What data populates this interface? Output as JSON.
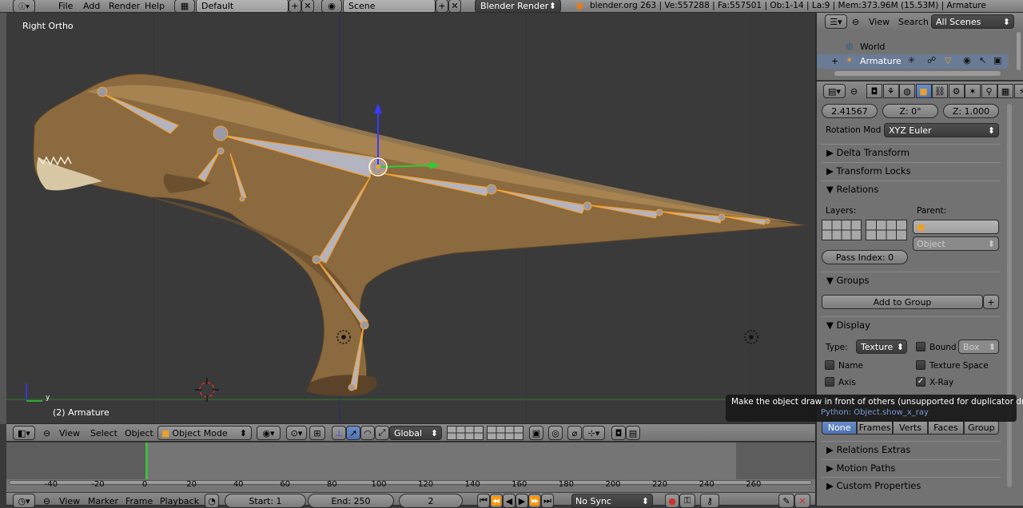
{
  "top_bar": {
    "menus": [
      "File",
      "Add",
      "Render",
      "Help"
    ],
    "screen_layout": "Default",
    "scene": "Scene",
    "render_engine": "Blender Render",
    "stats": "blender.org 263 | Ve:557288 | Fa:557501 | Ob:1-14 | La:9 | Mem:373.96M (15.53M) | Armature"
  },
  "viewport": {
    "view_label": "Right Ortho",
    "object_label": "(2) Armature",
    "axis_label": "y"
  },
  "view3d_header": {
    "menus": [
      "View",
      "Select",
      "Object"
    ],
    "mode": "Object Mode",
    "orientation": "Global"
  },
  "timeline": {
    "ticks": [
      "-40",
      "-20",
      "0",
      "20",
      "40",
      "60",
      "80",
      "100",
      "120",
      "140",
      "160",
      "180",
      "200",
      "220",
      "240",
      "260"
    ],
    "current_frame_marker": "0"
  },
  "timeline_header": {
    "menus": [
      "View",
      "Marker",
      "Frame",
      "Playback"
    ],
    "start": "Start: 1",
    "end": "End: 250",
    "current": "2",
    "sync": "No Sync"
  },
  "outliner": {
    "menus": [
      "View",
      "Search"
    ],
    "scene_filter": "All Scenes",
    "items": [
      "World",
      "Armature"
    ]
  },
  "properties": {
    "scale_x": "2.41567",
    "scale_z_rot": "Z: 0°",
    "scale_z": "Z: 1.000",
    "rotation_mode_label": "Rotation Mod",
    "rotation_mode": "XYZ Euler",
    "panels": {
      "delta_transform": "Delta Transform",
      "transform_locks": "Transform Locks",
      "relations": "Relations",
      "groups": "Groups",
      "display": "Display",
      "relations_extras": "Relations Extras",
      "motion_paths": "Motion Paths",
      "custom_properties": "Custom Properties"
    },
    "layers_label": "Layers:",
    "parent_label": "Parent:",
    "parent_type": "Object",
    "pass_index": "Pass Index: 0",
    "add_to_group": "Add to Group",
    "type_label": "Type:",
    "type_value": "Texture",
    "bound_label": "Bound",
    "bound_value": "Box",
    "name_label": "Name",
    "texture_space_label": "Texture Space",
    "axis_label": "Axis",
    "xray_label": "X-Ray",
    "xray_checked": true,
    "dup_tabs": [
      "None",
      "Frames",
      "Verts",
      "Faces",
      "Group"
    ]
  },
  "tooltip": {
    "text": "Make the object draw in front of others (unsupported for duplicator drawing)",
    "python": "Python: Object.show_x_ray"
  },
  "colors": {
    "accent": "#5680c2",
    "bone_outline": "#f5a030",
    "playhead": "#3fbf3f"
  }
}
